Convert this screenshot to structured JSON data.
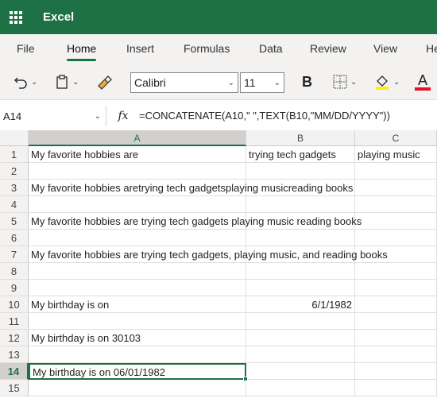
{
  "app": {
    "title": "Excel"
  },
  "ribbon": {
    "tabs": [
      {
        "label": "File"
      },
      {
        "label": "Home"
      },
      {
        "label": "Insert"
      },
      {
        "label": "Formulas"
      },
      {
        "label": "Data"
      },
      {
        "label": "Review"
      },
      {
        "label": "View"
      },
      {
        "label": "He"
      }
    ],
    "active_tab": "Home",
    "font_name": "Calibri",
    "font_size": "11",
    "bold_label": "B",
    "font_color_label": "A",
    "fill_color": "#ffef00",
    "font_color": "#e81123",
    "icons": [
      "undo-icon",
      "paste-icon",
      "format-painter-icon",
      "borders-icon",
      "fill-color-icon",
      "font-color-icon"
    ]
  },
  "formula_bar": {
    "name_box": "A14",
    "fx_label": "fx",
    "formula": "=CONCATENATE(A10,\" \",TEXT(B10,\"MM/DD/YYYY\"))"
  },
  "sheet": {
    "columns": [
      "A",
      "B",
      "C"
    ],
    "active_column": "A",
    "active_row": "14",
    "rows": [
      {
        "row": "1",
        "A": "My favorite hobbies are",
        "B": "trying tech gadgets",
        "C": "playing music"
      },
      {
        "row": "2",
        "A": "",
        "B": "",
        "C": ""
      },
      {
        "row": "3",
        "A": "My favorite hobbies aretrying tech gadgetsplaying musicreading books",
        "B": "",
        "C": ""
      },
      {
        "row": "4",
        "A": "",
        "B": "",
        "C": ""
      },
      {
        "row": "5",
        "A": "My favorite hobbies are trying tech gadgets playing music reading books",
        "B": "",
        "C": ""
      },
      {
        "row": "6",
        "A": "",
        "B": "",
        "C": ""
      },
      {
        "row": "7",
        "A": "My favorite hobbies are trying tech gadgets, playing music, and reading books",
        "B": "",
        "C": ""
      },
      {
        "row": "8",
        "A": "",
        "B": "",
        "C": ""
      },
      {
        "row": "9",
        "A": "",
        "B": "",
        "C": ""
      },
      {
        "row": "10",
        "A": "My birthday is on",
        "B": "6/1/1982",
        "C": ""
      },
      {
        "row": "11",
        "A": "",
        "B": "",
        "C": ""
      },
      {
        "row": "12",
        "A": "My birthday is on 30103",
        "B": "",
        "C": ""
      },
      {
        "row": "13",
        "A": "",
        "B": "",
        "C": ""
      },
      {
        "row": "14",
        "A": "My birthday is on 06/01/1982",
        "B": "",
        "C": ""
      },
      {
        "row": "15",
        "A": "",
        "B": "",
        "C": ""
      }
    ]
  },
  "colors": {
    "brand": "#1e7145",
    "ribbon_bg": "#f3f2f1"
  }
}
